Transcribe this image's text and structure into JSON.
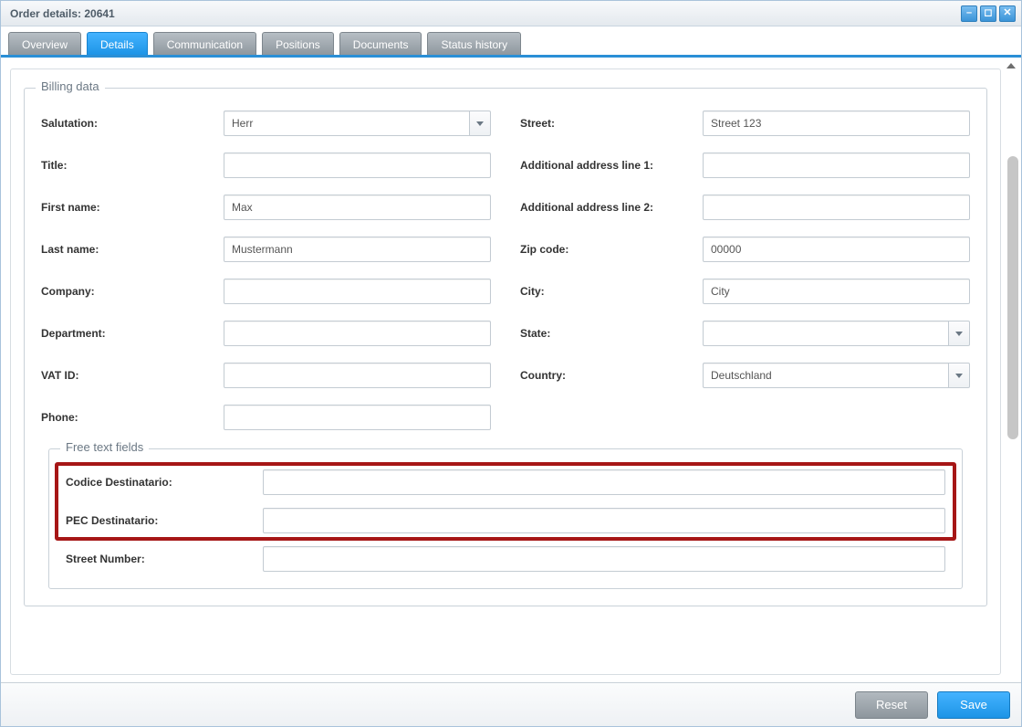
{
  "window": {
    "title": "Order details: 20641"
  },
  "tabs": [
    {
      "label": "Overview"
    },
    {
      "label": "Details"
    },
    {
      "label": "Communication"
    },
    {
      "label": "Positions"
    },
    {
      "label": "Documents"
    },
    {
      "label": "Status history"
    }
  ],
  "active_tab_index": 1,
  "billing": {
    "legend": "Billing data",
    "left": {
      "salutation": {
        "label": "Salutation:",
        "value": "Herr"
      },
      "title": {
        "label": "Title:",
        "value": ""
      },
      "first_name": {
        "label": "First name:",
        "value": "Max"
      },
      "last_name": {
        "label": "Last name:",
        "value": "Mustermann"
      },
      "company": {
        "label": "Company:",
        "value": ""
      },
      "department": {
        "label": "Department:",
        "value": ""
      },
      "vat_id": {
        "label": "VAT ID:",
        "value": ""
      },
      "phone": {
        "label": "Phone:",
        "value": ""
      }
    },
    "right": {
      "street": {
        "label": "Street:",
        "value": "Street 123"
      },
      "addr1": {
        "label": "Additional address line 1:",
        "value": ""
      },
      "addr2": {
        "label": "Additional address line 2:",
        "value": ""
      },
      "zip": {
        "label": "Zip code:",
        "value": "00000"
      },
      "city": {
        "label": "City:",
        "value": "City"
      },
      "state": {
        "label": "State:",
        "value": ""
      },
      "country": {
        "label": "Country:",
        "value": "Deutschland"
      }
    }
  },
  "free_text": {
    "legend": "Free text fields",
    "codice": {
      "label": "Codice Destinatario:",
      "value": ""
    },
    "pec": {
      "label": "PEC Destinatario:",
      "value": ""
    },
    "street_no": {
      "label": "Street Number:",
      "value": ""
    }
  },
  "footer": {
    "reset": "Reset",
    "save": "Save"
  }
}
